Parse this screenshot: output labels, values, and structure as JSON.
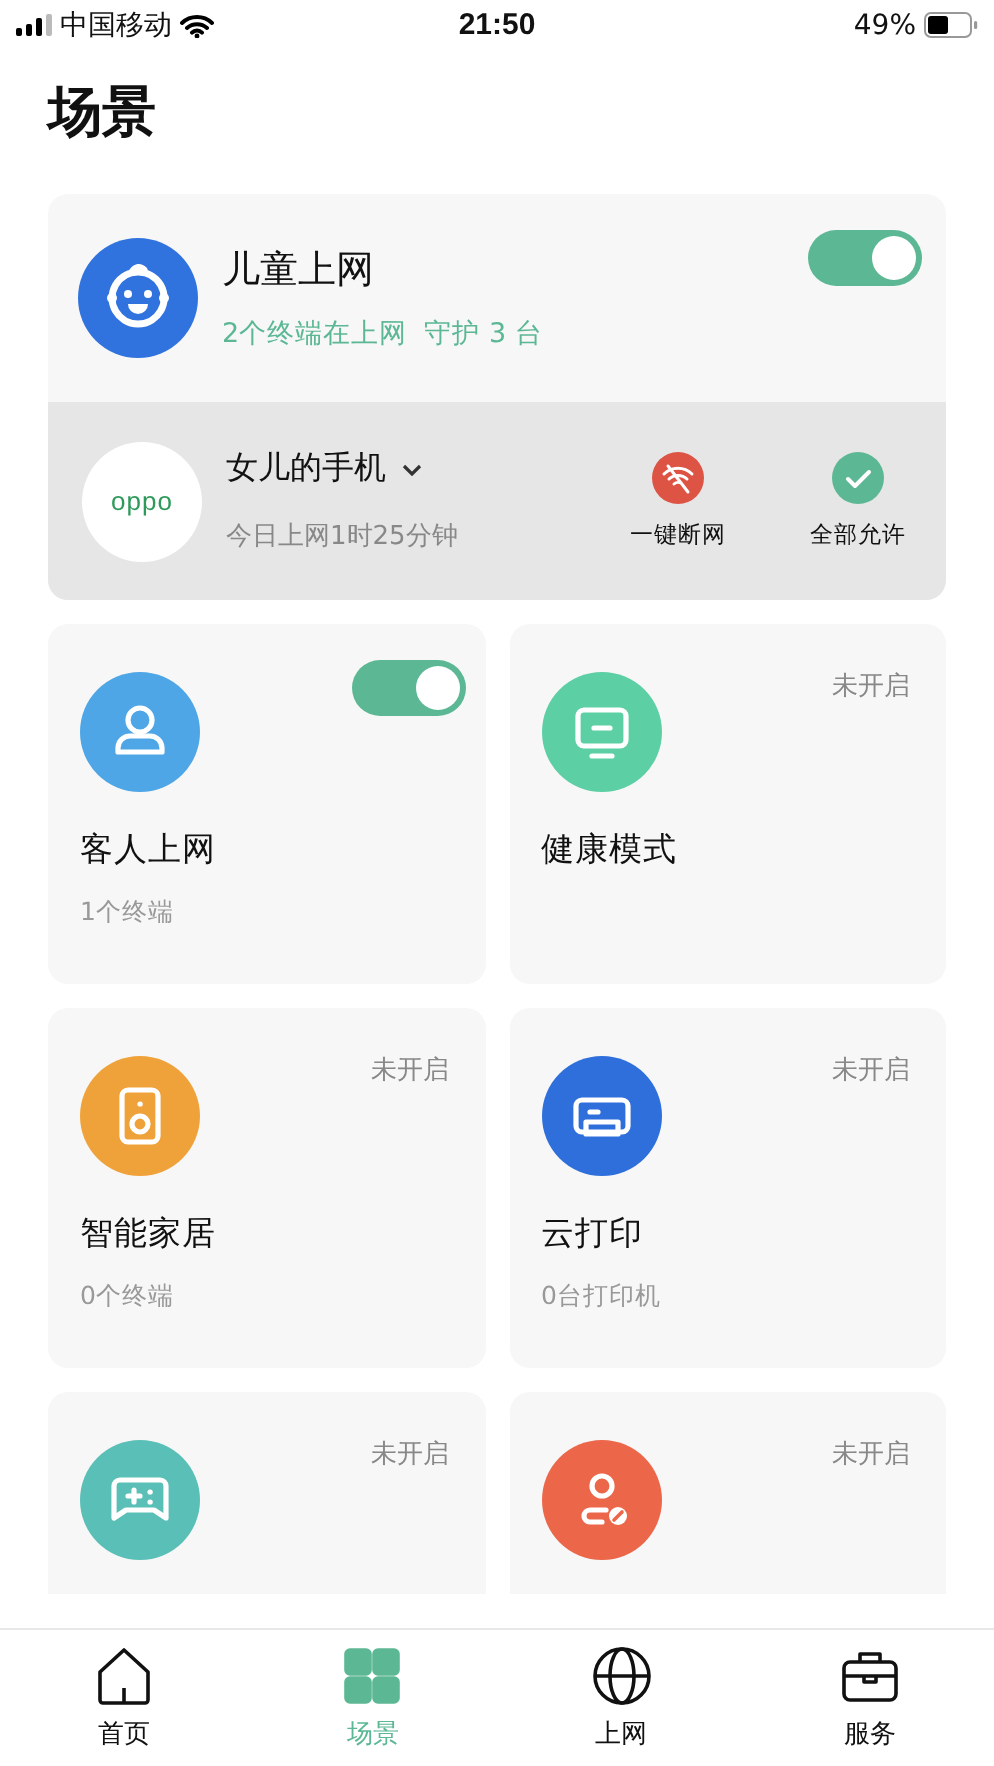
{
  "status_bar": {
    "carrier": "中国移动",
    "time": "21:50",
    "battery": "49%"
  },
  "title": "场景",
  "featured": {
    "title": "儿童上网",
    "color": "#3173de",
    "subtitle": "2个终端在上网  守护 3 台",
    "toggle": {
      "on": true
    },
    "device": {
      "logo": "oppo",
      "name": "女儿的手机",
      "usage": "今日上网1时25分钟"
    },
    "actions": [
      {
        "label": "一键断网",
        "color": "#dd5445"
      },
      {
        "label": "全部允许",
        "color": "#5cb894"
      }
    ]
  },
  "scenes": [
    {
      "title": "客人上网",
      "subtitle": "1个终端",
      "color": "#4ea6e6",
      "toggle": {
        "on": true
      }
    },
    {
      "title": "健康模式",
      "color": "#5ccfa5",
      "status": "未开启"
    },
    {
      "title": "智能家居",
      "subtitle": "0个终端",
      "color": "#f0a23a",
      "status": "未开启"
    },
    {
      "title": "云打印",
      "subtitle": "0台打印机",
      "color": "#2f6fdc",
      "status": "未开启"
    },
    {
      "color": "#5abfb6",
      "status": "未开启"
    },
    {
      "color": "#ec664a",
      "status": "未开启"
    }
  ],
  "tabs": [
    {
      "label": "首页",
      "selected": false
    },
    {
      "label": "场景",
      "selected": true
    },
    {
      "label": "上网",
      "selected": false
    },
    {
      "label": "服务",
      "selected": false
    }
  ]
}
